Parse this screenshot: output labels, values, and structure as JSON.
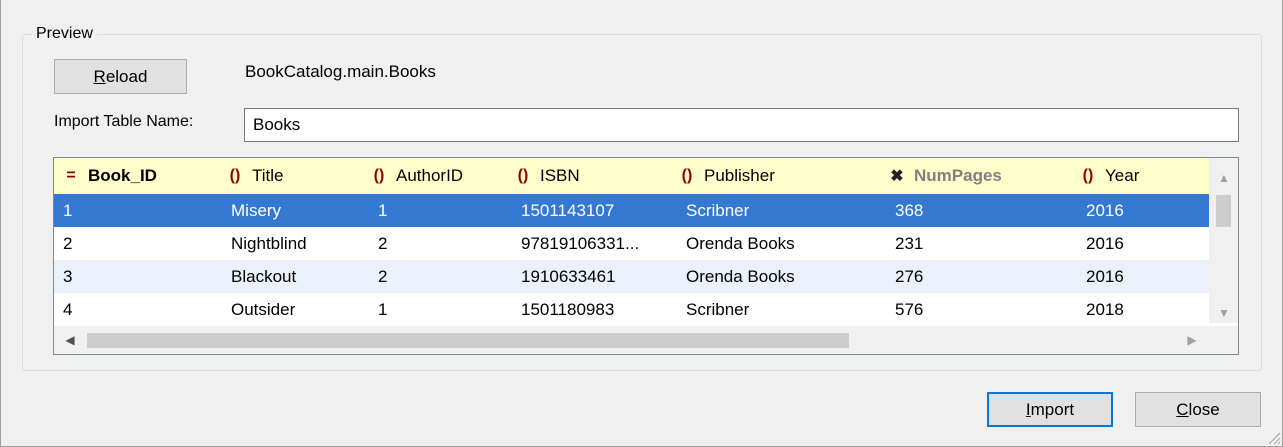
{
  "preview": {
    "group_label": "Preview",
    "reload_label_mnemonic": "R",
    "reload_label_rest": "eload",
    "source_path": "BookCatalog.main.Books",
    "import_table_name_label": "Import Table Name:",
    "import_table_name_value": "Books"
  },
  "grid": {
    "columns": [
      {
        "label": "Book_ID",
        "icon": "primary-key-icon",
        "glyph": "="
      },
      {
        "label": "Title",
        "icon": "braces-icon",
        "glyph": "()"
      },
      {
        "label": "AuthorID",
        "icon": "braces-icon",
        "glyph": "()"
      },
      {
        "label": "ISBN",
        "icon": "braces-icon",
        "glyph": "()"
      },
      {
        "label": "Publisher",
        "icon": "braces-icon",
        "glyph": "()"
      },
      {
        "label": "NumPages",
        "icon": "excluded-column-icon",
        "glyph": "✖"
      },
      {
        "label": "Year",
        "icon": "braces-icon",
        "glyph": "()"
      }
    ],
    "rows": [
      [
        "1",
        "Misery",
        "1",
        "1501143107",
        "Scribner",
        "368",
        "2016"
      ],
      [
        "2",
        "Nightblind",
        "2",
        "97819106331...",
        "Orenda Books",
        "231",
        "2016"
      ],
      [
        "3",
        "Blackout",
        "2",
        "1910633461",
        "Orenda Books",
        "276",
        "2016"
      ],
      [
        "4",
        "Outsider",
        "1",
        "1501180983",
        "Scribner",
        "576",
        "2018"
      ]
    ],
    "selected_row": 0
  },
  "footer": {
    "import_label_mnemonic": "I",
    "import_label_rest": "mport",
    "close_label_mnemonic": "C",
    "close_label_rest": "lose"
  },
  "colors": {
    "header_bg": "#ffffcc",
    "selection": "#3478d1",
    "alt_row": "#eaf1fb",
    "default_button_border": "#0078d7"
  }
}
